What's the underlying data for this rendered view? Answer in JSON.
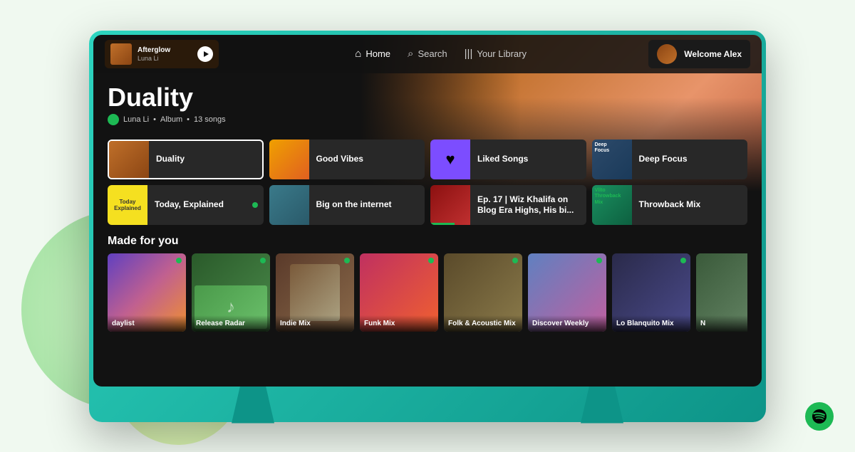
{
  "background": {
    "colors": [
      "#c8f0c0",
      "#a0e0a0",
      "#e8f8d0",
      "#d0f0a0"
    ]
  },
  "tv": {
    "frame_color": "#0d9488"
  },
  "navbar": {
    "now_playing": {
      "title": "Afterglow",
      "artist": "Luna Li"
    },
    "links": [
      {
        "id": "home",
        "label": "Home",
        "icon": "🏠",
        "active": true
      },
      {
        "id": "search",
        "label": "Search",
        "icon": "🔍",
        "active": false
      },
      {
        "id": "library",
        "label": "Your Library",
        "icon": "|||",
        "active": false
      }
    ],
    "user": {
      "welcome": "Welcome Alex"
    }
  },
  "hero": {
    "album_title": "Duality",
    "artist": "Luna Li",
    "type": "Album",
    "song_count": "13 songs"
  },
  "cards": [
    {
      "id": "duality",
      "label": "Duality",
      "active": true
    },
    {
      "id": "good-vibes",
      "label": "Good Vibes",
      "active": false
    },
    {
      "id": "liked-songs",
      "label": "Liked Songs",
      "active": false
    },
    {
      "id": "deep-focus",
      "label": "Deep Focus",
      "active": false
    },
    {
      "id": "today-explained",
      "label": "Today, Explained",
      "active": false,
      "has_dot": true
    },
    {
      "id": "big-on-internet",
      "label": "Big on the internet",
      "active": false
    },
    {
      "id": "ep17",
      "label": "Ep. 17 | Wiz Khalifa on Blog Era Highs, His bi...",
      "active": false
    },
    {
      "id": "throwback-mix",
      "label": "Throwback Mix",
      "active": false
    }
  ],
  "made_for_you": {
    "title": "Made for you",
    "items": [
      {
        "id": "daylist",
        "label": "daylist",
        "dot_color": "#1db954"
      },
      {
        "id": "release-radar",
        "label": "Release Radar",
        "dot_color": "#1db954"
      },
      {
        "id": "indie-mix",
        "label": "Indie Mix",
        "dot_color": "#1db954"
      },
      {
        "id": "funk-mix",
        "label": "Funk Mix",
        "dot_color": "#1db954"
      },
      {
        "id": "folk-acoustic",
        "label": "Folk & Acoustic Mix",
        "dot_color": "#1db954"
      },
      {
        "id": "discover-weekly",
        "label": "Discover Weekly",
        "dot_color": "#1db954"
      },
      {
        "id": "lo-blanquito",
        "label": "Lo Blanquito Mix",
        "dot_color": "#1db954"
      },
      {
        "id": "n-mix",
        "label": "N",
        "dot_color": "#1db954"
      }
    ]
  },
  "spotify": {
    "logo_color": "#1db954"
  }
}
